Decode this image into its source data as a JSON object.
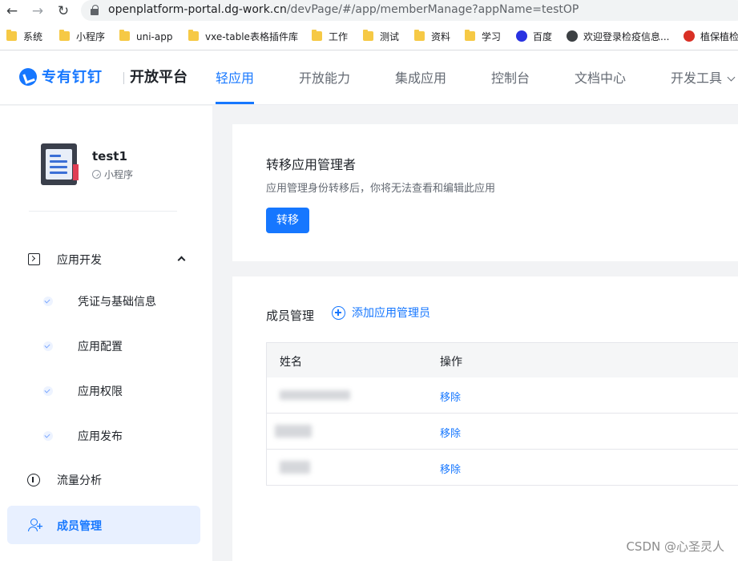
{
  "browser": {
    "url_host": "openplatform-portal.dg-work.cn",
    "url_path": "/devPage/#/app/memberManage?appName=testOP",
    "bookmarks": [
      "系统",
      "小程序",
      "uni-app",
      "vxe-table表格插件库",
      "工作",
      "测试",
      "资料",
      "学习",
      "百度",
      "欢迎登录检疫信息...",
      "植保植检"
    ]
  },
  "header": {
    "logo_text": "专有钉钉",
    "logo_sub": "开放平台",
    "nav": [
      "轻应用",
      "开放能力",
      "集成应用",
      "控制台",
      "文档中心",
      "开发工具"
    ],
    "active_nav": "轻应用"
  },
  "sidebar": {
    "app_name": "test1",
    "app_type": "小程序",
    "group_label": "应用开发",
    "sub_items": [
      "凭证与基础信息",
      "应用配置",
      "应用权限",
      "应用发布"
    ],
    "traffic_label": "流量分析",
    "member_label": "成员管理"
  },
  "transfer": {
    "title": "转移应用管理者",
    "desc": "应用管理身份转移后，你将无法查看和编辑此应用",
    "button": "转移"
  },
  "members": {
    "title": "成员管理",
    "add_label": "添加应用管理员",
    "columns": [
      "姓名",
      "操作"
    ],
    "rows": [
      {
        "action": "移除"
      },
      {
        "action": "移除"
      },
      {
        "action": "移除"
      }
    ]
  },
  "watermark": "CSDN @心圣灵人",
  "colors": {
    "accent": "#1677ff",
    "active_bg": "#e8f0ff"
  }
}
